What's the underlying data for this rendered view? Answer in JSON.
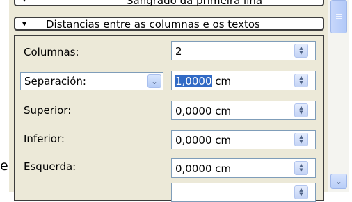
{
  "sections": {
    "top_label": "Sangrado da primeira liña",
    "main_label": "Distancias entre as columnas e os textos"
  },
  "rows": [
    {
      "label": "Columnas:",
      "value": "2"
    },
    {
      "label": "Separación:",
      "value_selected": "1,0000",
      "value_rest": " cm"
    },
    {
      "label": "Superior:",
      "value": "0,0000 cm"
    },
    {
      "label": "Inferior:",
      "value": "0,0000 cm"
    },
    {
      "label": "Esquerda:",
      "value": "0,0000 cm"
    }
  ],
  "stray_text": "e",
  "icons": {
    "bullet": "triangle-bullet-icon",
    "combo": "chevron-down-icon",
    "spin": "spin-up-down-icon",
    "scroll": "chevron-down-icon"
  }
}
